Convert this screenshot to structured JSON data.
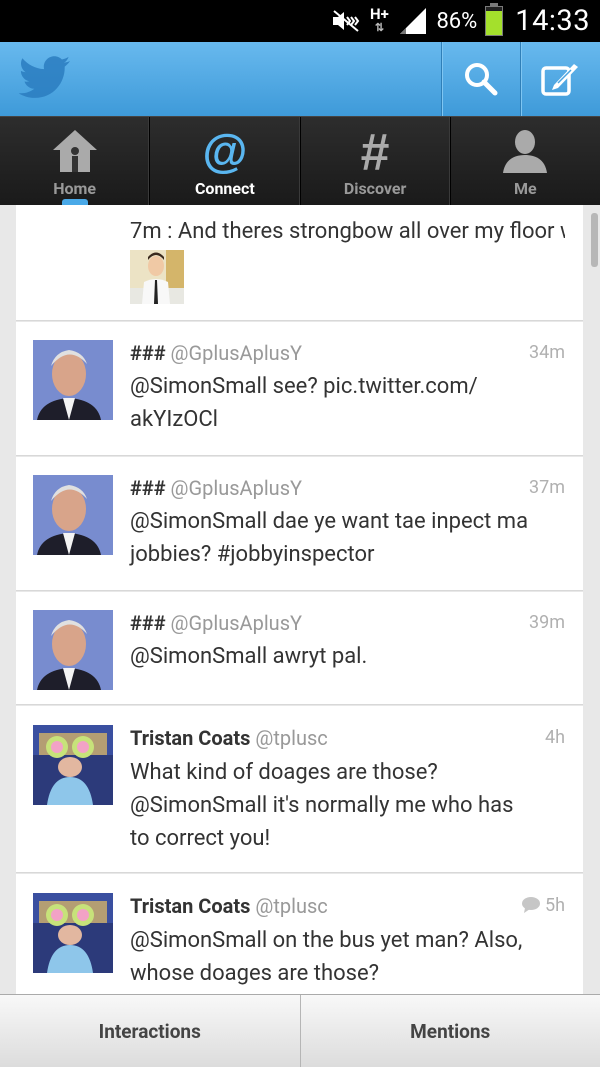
{
  "status_bar": {
    "network_type": "H+",
    "battery_percent": "86%",
    "battery_level": 0.86,
    "time": "14:33",
    "icons": [
      "mute-icon",
      "data-arrows-icon",
      "signal-icon",
      "battery-icon"
    ]
  },
  "app_bar": {
    "logo": "twitter-bird-logo",
    "actions": [
      "search-icon",
      "compose-icon"
    ]
  },
  "tabs": [
    {
      "label": "Home",
      "icon": "home-icon",
      "active": false
    },
    {
      "label": "Connect",
      "icon": "at-icon",
      "active": true
    },
    {
      "label": "Discover",
      "icon": "hash-icon",
      "active": false
    },
    {
      "label": "Me",
      "icon": "person-icon",
      "active": false
    }
  ],
  "timeline": {
    "truncated_item": {
      "text": "7m : And theres strongbow all over my floor w..."
    },
    "tweets": [
      {
        "name": "###",
        "handle": "@GplusAplusY",
        "time": "34m",
        "lines": [
          "@SimonSmall see? pic.twitter.com/",
          "akYIzOCl"
        ]
      },
      {
        "name": "###",
        "handle": "@GplusAplusY",
        "time": "37m",
        "lines": [
          "@SimonSmall dae ye want tae inpect ma",
          "jobbies? #jobbyinspector"
        ]
      },
      {
        "name": "###",
        "handle": "@GplusAplusY",
        "time": "39m",
        "lines": [
          "@SimonSmall awryt pal."
        ]
      },
      {
        "name": "Tristan Coats",
        "handle": "@tplusc",
        "time": "4h",
        "lines": [
          "What kind of doages are those?",
          "@SimonSmall it's normally me who has",
          "to correct you!"
        ]
      },
      {
        "name": "Tristan Coats",
        "handle": "@tplusc",
        "time": "5h",
        "lines": [
          "@SimonSmall on the bus yet man? Also,",
          "whose doages are those?"
        ]
      }
    ]
  },
  "bottom_tabs": {
    "interactions": "Interactions",
    "mentions": "Mentions"
  },
  "colors": {
    "app_bar": "#4aa4e0",
    "accent": "#49a9e8",
    "battery": "#a4e02c"
  }
}
